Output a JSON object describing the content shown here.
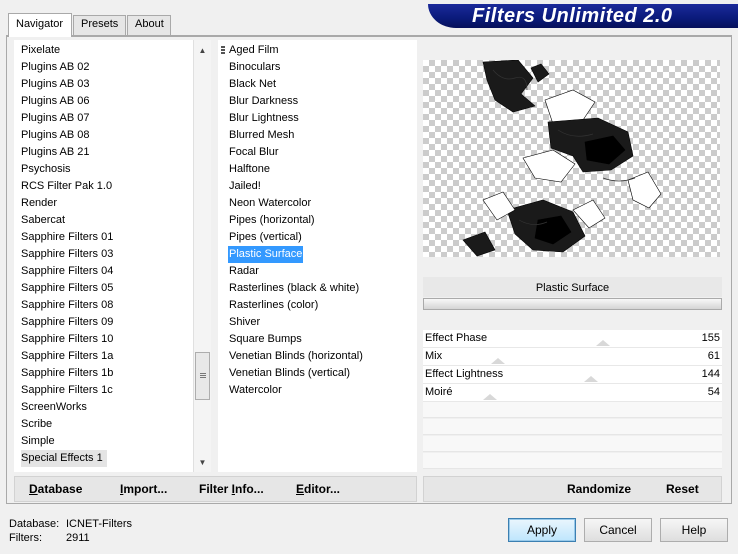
{
  "tabs": [
    {
      "label": "Navigator",
      "active": true
    },
    {
      "label": "Presets",
      "active": false
    },
    {
      "label": "About",
      "active": false
    }
  ],
  "banner": {
    "title": "Filters Unlimited 2.0"
  },
  "categories": {
    "items": [
      "Pixelate",
      "Plugins AB 02",
      "Plugins AB 03",
      "Plugins AB 06",
      "Plugins AB 07",
      "Plugins AB 08",
      "Plugins AB 21",
      "Psychosis",
      "RCS Filter Pak 1.0",
      "Render",
      "Sabercat",
      "Sapphire Filters 01",
      "Sapphire Filters 03",
      "Sapphire Filters 04",
      "Sapphire Filters 05",
      "Sapphire Filters 08",
      "Sapphire Filters 09",
      "Sapphire Filters 10",
      "Sapphire Filters 1a",
      "Sapphire Filters 1b",
      "Sapphire Filters 1c",
      "ScreenWorks",
      "Scribe",
      "Simple",
      "Special Effects 1"
    ],
    "selected": "Special Effects 1",
    "scroll_up_icon": "triangle-up",
    "scroll_down_icon": "triangle-down"
  },
  "filters": {
    "items": [
      "Aged Film",
      "Binoculars",
      "Black Net",
      "Blur Darkness",
      "Blur Lightness",
      "Blurred Mesh",
      "Focal Blur",
      "Halftone",
      "Jailed!",
      "Neon Watercolor",
      "Pipes (horizontal)",
      "Pipes (vertical)",
      "Plastic Surface",
      "Radar",
      "Rasterlines (black & white)",
      "Rasterlines (color)",
      "Shiver",
      "Square Bumps",
      "Venetian Blinds (horizontal)",
      "Venetian Blinds (vertical)",
      "Watercolor"
    ],
    "selected": "Plastic Surface"
  },
  "filter_name": "Plastic Surface",
  "parameters": [
    {
      "label": "Effect Phase",
      "value": "155",
      "fraction": 0.608
    },
    {
      "label": "Mix",
      "value": "61",
      "fraction": 0.239
    },
    {
      "label": "Effect Lightness",
      "value": "144",
      "fraction": 0.565
    },
    {
      "label": "Moiré",
      "value": "54",
      "fraction": 0.212
    }
  ],
  "left_buttons": {
    "database": "Database",
    "import": "Import...",
    "filter_info": "Filter Info...",
    "editor": "Editor..."
  },
  "right_buttons": {
    "randomize": "Randomize",
    "reset": "Reset"
  },
  "status": {
    "database_label": "Database:",
    "database_value": "ICNET-Filters",
    "filters_label": "Filters:",
    "filters_value": "2911"
  },
  "dialog_buttons": {
    "apply": "Apply",
    "cancel": "Cancel",
    "help": "Help"
  },
  "colors": {
    "banner": "#0a1a7a",
    "selection": "#3399ff"
  }
}
